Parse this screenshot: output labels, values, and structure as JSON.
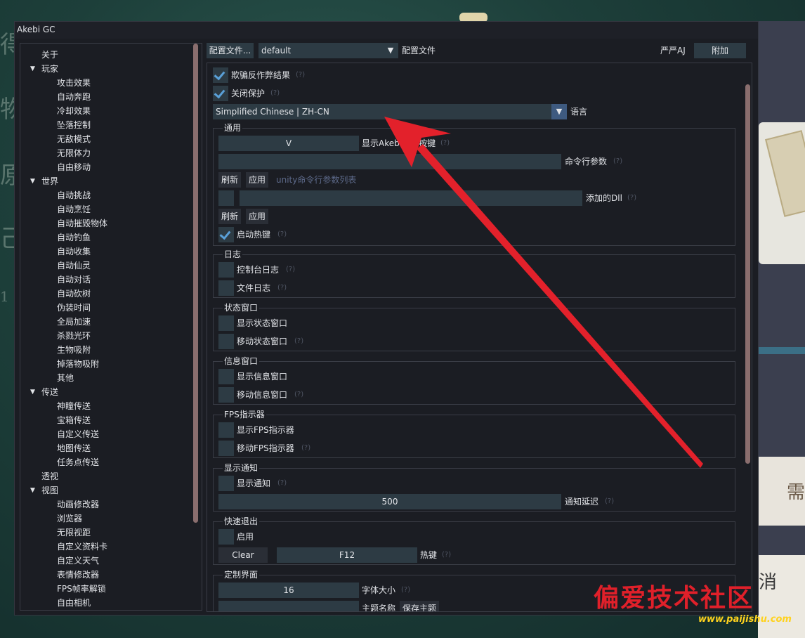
{
  "window": {
    "title": "Akebi GC"
  },
  "sidebar": {
    "items": [
      {
        "label": "关于",
        "level": 0,
        "arrow": ""
      },
      {
        "label": "玩家",
        "level": 0,
        "arrow": "▼"
      },
      {
        "label": "攻击效果",
        "level": 1,
        "arrow": ""
      },
      {
        "label": "自动奔跑",
        "level": 1,
        "arrow": ""
      },
      {
        "label": "冷却效果",
        "level": 1,
        "arrow": ""
      },
      {
        "label": "坠落控制",
        "level": 1,
        "arrow": ""
      },
      {
        "label": "无敌模式",
        "level": 1,
        "arrow": ""
      },
      {
        "label": "无限体力",
        "level": 1,
        "arrow": ""
      },
      {
        "label": "自由移动",
        "level": 1,
        "arrow": ""
      },
      {
        "label": "世界",
        "level": 0,
        "arrow": "▼"
      },
      {
        "label": "自动挑战",
        "level": 1,
        "arrow": ""
      },
      {
        "label": "自动烹饪",
        "level": 1,
        "arrow": ""
      },
      {
        "label": "自动摧毁物体",
        "level": 1,
        "arrow": ""
      },
      {
        "label": "自动钓鱼",
        "level": 1,
        "arrow": ""
      },
      {
        "label": "自动收集",
        "level": 1,
        "arrow": ""
      },
      {
        "label": "自动仙灵",
        "level": 1,
        "arrow": ""
      },
      {
        "label": "自动对话",
        "level": 1,
        "arrow": ""
      },
      {
        "label": "自动砍树",
        "level": 1,
        "arrow": ""
      },
      {
        "label": "伪装时间",
        "level": 1,
        "arrow": ""
      },
      {
        "label": "全局加速",
        "level": 1,
        "arrow": ""
      },
      {
        "label": "杀戮光环",
        "level": 1,
        "arrow": ""
      },
      {
        "label": "生物吸附",
        "level": 1,
        "arrow": ""
      },
      {
        "label": "掉落物吸附",
        "level": 1,
        "arrow": ""
      },
      {
        "label": "其他",
        "level": 1,
        "arrow": ""
      },
      {
        "label": "传送",
        "level": 0,
        "arrow": "▼"
      },
      {
        "label": "神瞳传送",
        "level": 1,
        "arrow": ""
      },
      {
        "label": "宝箱传送",
        "level": 1,
        "arrow": ""
      },
      {
        "label": "自定义传送",
        "level": 1,
        "arrow": ""
      },
      {
        "label": "地图传送",
        "level": 1,
        "arrow": ""
      },
      {
        "label": "任务点传送",
        "level": 1,
        "arrow": ""
      },
      {
        "label": "透视",
        "level": 0,
        "arrow": ""
      },
      {
        "label": "视图",
        "level": 0,
        "arrow": "▼"
      },
      {
        "label": "动画修改器",
        "level": 1,
        "arrow": ""
      },
      {
        "label": "浏览器",
        "level": 1,
        "arrow": ""
      },
      {
        "label": "无限视距",
        "level": 1,
        "arrow": ""
      },
      {
        "label": "自定义资料卡",
        "level": 1,
        "arrow": ""
      },
      {
        "label": "自定义天气",
        "level": 1,
        "arrow": ""
      },
      {
        "label": "表情修改器",
        "level": 1,
        "arrow": ""
      },
      {
        "label": "FPS帧率解锁",
        "level": 1,
        "arrow": ""
      },
      {
        "label": "自由相机",
        "level": 1,
        "arrow": ""
      }
    ]
  },
  "topbar": {
    "profile_button": "配置文件...",
    "profile_value": "default",
    "profile_label": "配置文件",
    "user": "严严AJ",
    "attach_button": "附加"
  },
  "content": {
    "cheat_result": "欺骗反作弊结果",
    "close_protect": "关闭保护",
    "hint": "(?)",
    "language_value": "Simplified Chinese | ZH-CN",
    "language_label": "语言",
    "general": {
      "title": "通用",
      "menu_key": "V",
      "menu_key_label": "显示Akebi菜单按键",
      "cmd_label": "命令行参数",
      "refresh": "刷新",
      "apply": "应用",
      "unity_link": "unity命令行参数列表",
      "dll_label": "添加的Dll",
      "hotkey": "启动热键"
    },
    "log": {
      "title": "日志",
      "console": "控制台日志",
      "file": "文件日志"
    },
    "status": {
      "title": "状态窗口",
      "show": "显示状态窗口",
      "move": "移动状态窗口"
    },
    "info": {
      "title": "信息窗口",
      "show": "显示信息窗口",
      "move": "移动信息窗口"
    },
    "fps": {
      "title": "FPS指示器",
      "show": "显示FPS指示器",
      "move": "移动FPS指示器"
    },
    "notify": {
      "title": "显示通知",
      "show": "显示通知",
      "delay_value": "500",
      "delay_label": "通知延迟"
    },
    "quit": {
      "title": "快速退出",
      "enable": "启用",
      "clear": "Clear",
      "key": "F12",
      "key_label": "热键"
    },
    "custom": {
      "title": "定制界面",
      "font_size": "16",
      "font_size_label": "字体大小",
      "theme_label": "主题名称",
      "save_theme": "保存主题"
    }
  },
  "watermark": {
    "main": "偏爱技术社区",
    "sub": "www.paijishu.com"
  },
  "background": {
    "lower_text": "需",
    "bottom_text": "消",
    "glyphs": [
      "得",
      "物",
      "原",
      "己",
      "1"
    ]
  },
  "colors": {
    "arrow": "#e3212b",
    "checkmark": "#5aa0d8",
    "accent": "#3e5a80"
  }
}
